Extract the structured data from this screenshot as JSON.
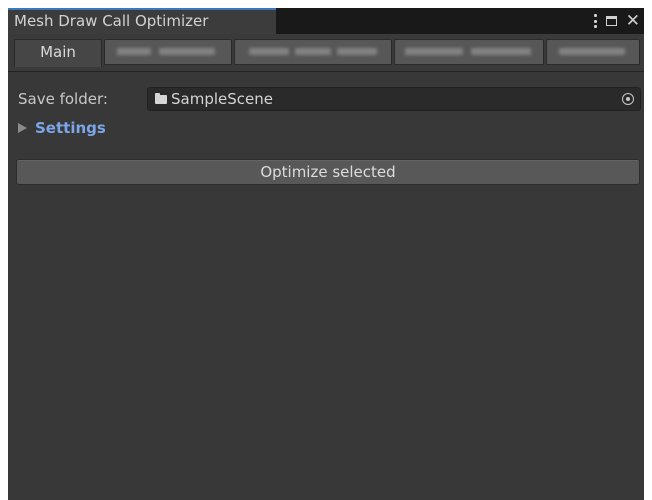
{
  "window": {
    "title": "Mesh Draw Call Optimizer"
  },
  "toolbar": {
    "tabs": [
      {
        "label": "Main",
        "active": true
      },
      {
        "label": "",
        "redacted": true
      },
      {
        "label": "",
        "redacted": true
      },
      {
        "label": "",
        "redacted": true
      },
      {
        "label": "",
        "redacted": true
      }
    ]
  },
  "form": {
    "save_folder_label": "Save folder:",
    "save_folder_value": "SampleScene",
    "settings_label": "Settings",
    "settings_expanded": false
  },
  "actions": {
    "optimize_label": "Optimize selected"
  },
  "icons": {
    "menu": "kebab-menu-icon",
    "maximize": "maximize-icon",
    "close": "close-icon",
    "folder": "folder-icon",
    "picker": "object-picker-icon",
    "foldout": "triangle-right-icon"
  },
  "colors": {
    "panel_bg": "#383838",
    "titlebar_bg": "#191919",
    "active_tab_accent": "#3a79bb",
    "foldout_text": "#7ba7e8",
    "button_bg": "#585858"
  }
}
